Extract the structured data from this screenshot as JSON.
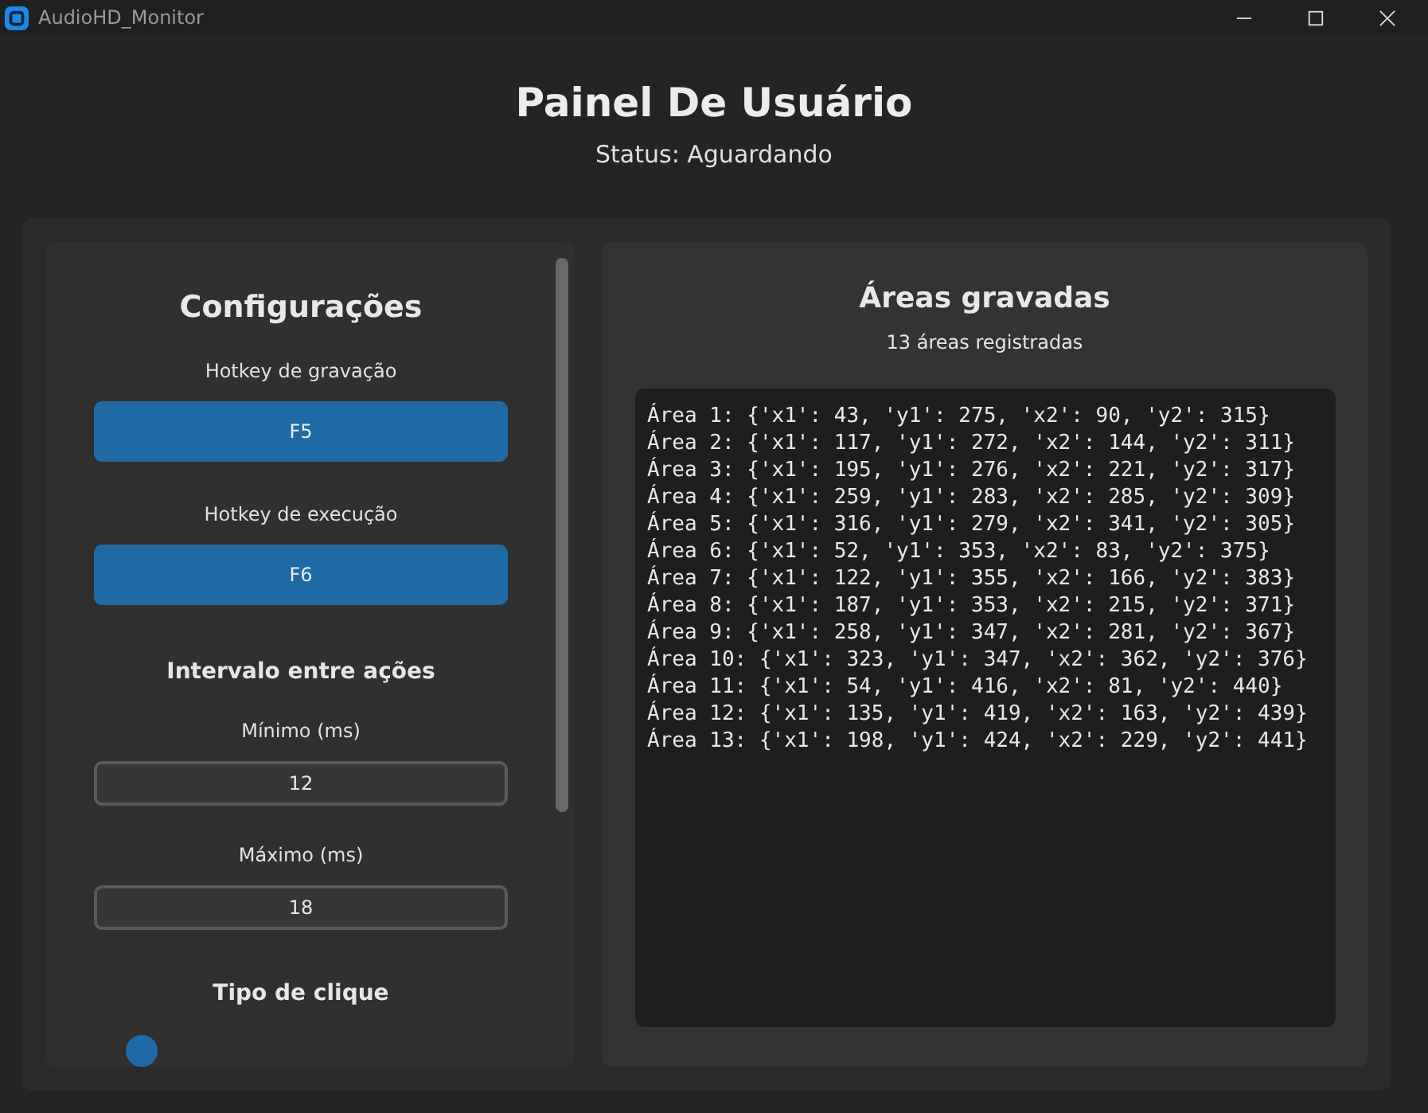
{
  "window": {
    "title": "AudioHD_Monitor"
  },
  "header": {
    "title": "Painel De Usuário",
    "status": "Status: Aguardando"
  },
  "settings": {
    "title": "Configurações",
    "hotkeys": [
      {
        "label": "Hotkey de gravação",
        "value": "F5"
      },
      {
        "label": "Hotkey de execução",
        "value": "F6"
      }
    ],
    "interval_title": "Intervalo entre ações",
    "intervals": [
      {
        "label": "Mínimo (ms)",
        "value": "12"
      },
      {
        "label": "Máximo (ms)",
        "value": "18"
      }
    ],
    "click_type_title": "Tipo de clique",
    "click_options": [
      {
        "selected": true
      }
    ]
  },
  "areas": {
    "title": "Áreas gravadas",
    "count": "13 áreas registradas",
    "lines": [
      "Área 1: {'x1': 43, 'y1': 275, 'x2': 90, 'y2': 315}",
      "Área 2: {'x1': 117, 'y1': 272, 'x2': 144, 'y2': 311}",
      "Área 3: {'x1': 195, 'y1': 276, 'x2': 221, 'y2': 317}",
      "Área 4: {'x1': 259, 'y1': 283, 'x2': 285, 'y2': 309}",
      "Área 5: {'x1': 316, 'y1': 279, 'x2': 341, 'y2': 305}",
      "Área 6: {'x1': 52, 'y1': 353, 'x2': 83, 'y2': 375}",
      "Área 7: {'x1': 122, 'y1': 355, 'x2': 166, 'y2': 383}",
      "Área 8: {'x1': 187, 'y1': 353, 'x2': 215, 'y2': 371}",
      "Área 9: {'x1': 258, 'y1': 347, 'x2': 281, 'y2': 367}",
      "Área 10: {'x1': 323, 'y1': 347, 'x2': 362, 'y2': 376}",
      "Área 11: {'x1': 54, 'y1': 416, 'x2': 81, 'y2': 440}",
      "Área 12: {'x1': 135, 'y1': 419, 'x2': 163, 'y2': 439}",
      "Área 13: {'x1': 198, 'y1': 424, 'x2': 229, 'y2': 441}"
    ]
  }
}
